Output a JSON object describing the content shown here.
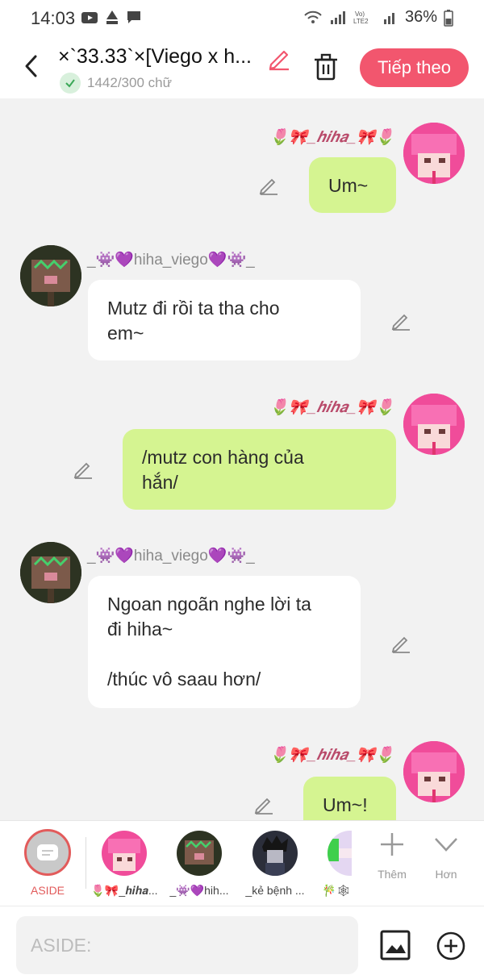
{
  "status_bar": {
    "time": "14:03",
    "battery": "36%"
  },
  "header": {
    "title": "×`33.33`×[Viego x h...",
    "word_count": "1442/300 chữ",
    "next_label": "Tiếp theo"
  },
  "messages": [
    {
      "sender": "🌷🎀_𝒉𝒊𝒉𝒂_🎀🌷",
      "text": "Um~"
    },
    {
      "sender": "_👾💜hiha_viego💜👾_",
      "text": "Mutz đi rồi ta tha cho\nem~"
    },
    {
      "sender": "🌷🎀_𝒉𝒊𝒉𝒂_🎀🌷",
      "text": "/mutz con hàng của\nhắn/"
    },
    {
      "sender": "_👾💜hiha_viego💜👾_",
      "text": "Ngoan ngoãn nghe lời ta\nđi hiha~\n\n/thúc vô saau hơn/"
    },
    {
      "sender": "🌷🎀_𝒉𝒊𝒉𝒂_🎀🌷",
      "text": "Um~!"
    }
  ],
  "character_bar": {
    "aside_label": "ASIDE",
    "characters": [
      "🌷🎀_𝒉𝒊𝒉𝒂...",
      "_👾💜hih...",
      "_kẻ bệnh ...",
      "🎋🕸"
    ],
    "add_label": "Thêm",
    "more_label": "Hơn"
  },
  "input": {
    "placeholder": "ASIDE:"
  },
  "colors": {
    "accent": "#f2566e",
    "bubble_green": "#d5f491",
    "aside_red": "#e25b5b"
  }
}
